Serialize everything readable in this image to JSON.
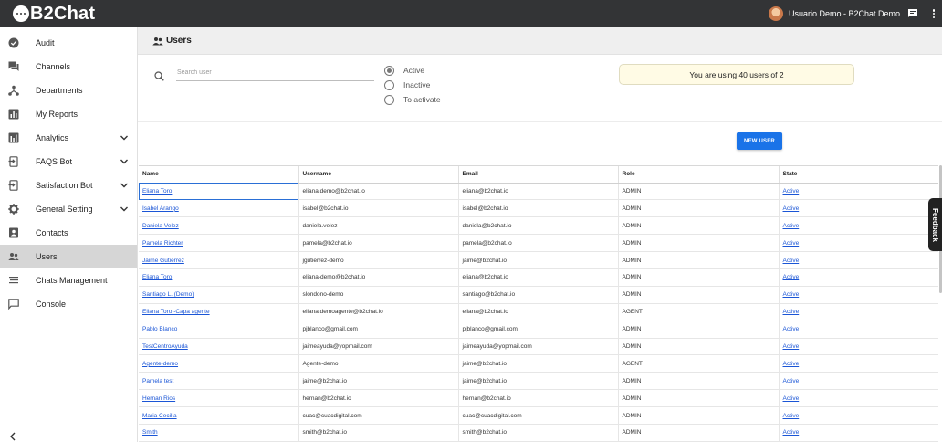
{
  "app": {
    "logo_text": "B2Chat",
    "user_name": "Usuario Demo - B2Chat Demo"
  },
  "sidebar": {
    "items": [
      {
        "label": "Audit",
        "icon": "check-circle-icon",
        "expandable": false,
        "active": false
      },
      {
        "label": "Channels",
        "icon": "chat-bubbles-icon",
        "expandable": false,
        "active": false
      },
      {
        "label": "Departments",
        "icon": "hierarchy-icon",
        "expandable": false,
        "active": false
      },
      {
        "label": "My Reports",
        "icon": "bar-chart-icon",
        "expandable": false,
        "active": false
      },
      {
        "label": "Analytics",
        "icon": "analytics-icon",
        "expandable": true,
        "active": false
      },
      {
        "label": "FAQS Bot",
        "icon": "bot-icon",
        "expandable": true,
        "active": false
      },
      {
        "label": "Satisfaction Bot",
        "icon": "bot-icon",
        "expandable": true,
        "active": false
      },
      {
        "label": "General Setting",
        "icon": "gear-icon",
        "expandable": true,
        "active": false
      },
      {
        "label": "Contacts",
        "icon": "contacts-icon",
        "expandable": false,
        "active": false
      },
      {
        "label": "Users",
        "icon": "users-icon",
        "expandable": false,
        "active": true
      },
      {
        "label": "Chats Management",
        "icon": "list-icon",
        "expandable": false,
        "active": false
      },
      {
        "label": "Console",
        "icon": "console-icon",
        "expandable": false,
        "active": false
      }
    ]
  },
  "page": {
    "title": "Users"
  },
  "filters": {
    "search_placeholder": "Search user",
    "search_value": "",
    "status_options": [
      {
        "label": "Active",
        "checked": true
      },
      {
        "label": "Inactive",
        "checked": false
      },
      {
        "label": "To activate",
        "checked": false
      }
    ]
  },
  "quota_banner": "You are using 40 users of 2",
  "new_user_label": "NEW USER",
  "feedback_label": "Feedback",
  "table": {
    "columns": [
      "Name",
      "Username",
      "Email",
      "Role",
      "State"
    ],
    "rows": [
      [
        "Eliana Toro",
        "eliana.demo@b2chat.io",
        "eliana@b2chat.io",
        "ADMIN",
        "Active"
      ],
      [
        "Isabel Arango",
        "isabel@b2chat.io",
        "isabel@b2chat.io",
        "ADMIN",
        "Active"
      ],
      [
        "Daniela Velez",
        "daniela.velez",
        "daniela@b2chat.io",
        "ADMIN",
        "Active"
      ],
      [
        "Pamela Richter",
        "pamela@b2chat.io",
        "pamela@b2chat.io",
        "ADMIN",
        "Active"
      ],
      [
        "Jaime Gutierrez",
        "jgutierrez-demo",
        "jaime@b2chat.io",
        "ADMIN",
        "Active"
      ],
      [
        "Eliana Toro",
        "eliana-demo@b2chat.io",
        "eliana@b2chat.io",
        "ADMIN",
        "Active"
      ],
      [
        "Santiago L. (Demo)",
        "slondono-demo",
        "santiago@b2chat.io",
        "ADMIN",
        "Active"
      ],
      [
        "Eliana Toro -Capa agente",
        "eliana.demoagente@b2chat.io",
        "eliana@b2chat.io",
        "AGENT",
        "Active"
      ],
      [
        "Pablo Blanco",
        "pjblanco@gmail.com",
        "pjblanco@gmail.com",
        "ADMIN",
        "Active"
      ],
      [
        "TestCentroAyuda",
        "jaimeayuda@yopmail.com",
        "jaimeayuda@yopmail.com",
        "ADMIN",
        "Active"
      ],
      [
        "Agente-demo",
        "Agente-demo",
        "jaime@b2chat.io",
        "AGENT",
        "Active"
      ],
      [
        "Pamela test",
        "jaime@b2chat.io",
        "jaime@b2chat.io",
        "ADMIN",
        "Active"
      ],
      [
        "Hernan Rios",
        "hernan@b2chat.io",
        "hernan@b2chat.io",
        "ADMIN",
        "Active"
      ],
      [
        "Maria Cecilia",
        "cuac@cuacdigital.com",
        "cuac@cuacdigital.com",
        "ADMIN",
        "Active"
      ],
      [
        "Smith",
        "smith@b2chat.io",
        "smith@b2chat.io",
        "ADMIN",
        "Active"
      ]
    ]
  },
  "colors": {
    "topbar": "#333436",
    "accent": "#1a73e8",
    "link": "#1a55d6",
    "active_nav": "#d6d6d6",
    "banner_bg": "#fffbe5"
  }
}
